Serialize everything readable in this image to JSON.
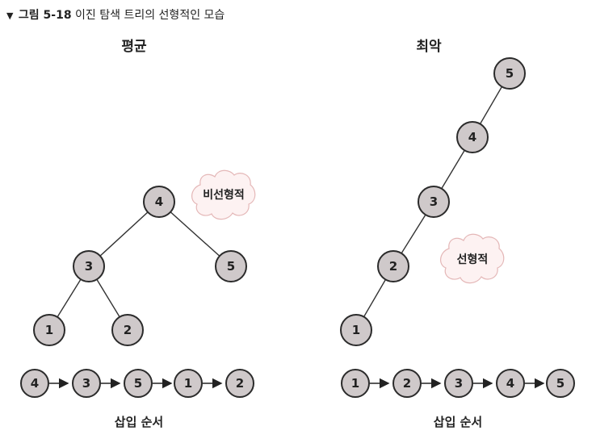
{
  "caption": {
    "marker": "▼",
    "figure_label": "그림 5-18",
    "text": "이진 탐색 트리의 선형적인 모습"
  },
  "panels": [
    {
      "title": "평균",
      "annotation": "비선형적",
      "tree_nodes": [
        "4",
        "3",
        "5",
        "1",
        "2"
      ],
      "tree_edges": [
        [
          "4",
          "3"
        ],
        [
          "4",
          "5"
        ],
        [
          "3",
          "1"
        ],
        [
          "3",
          "2"
        ]
      ],
      "insert_order": [
        "4",
        "3",
        "5",
        "1",
        "2"
      ],
      "insert_label": "삽입 순서"
    },
    {
      "title": "최악",
      "annotation": "선형적",
      "tree_nodes": [
        "5",
        "4",
        "3",
        "2",
        "1"
      ],
      "tree_edges": [
        [
          "5",
          "4"
        ],
        [
          "4",
          "3"
        ],
        [
          "3",
          "2"
        ],
        [
          "2",
          "1"
        ]
      ],
      "insert_order": [
        "1",
        "2",
        "3",
        "4",
        "5"
      ],
      "insert_label": "삽입 순서"
    }
  ],
  "colors": {
    "node_fill": "#cfc9ca",
    "node_stroke": "#2b2b2b",
    "cloud_fill": "#fdf2f2",
    "cloud_stroke": "#e4b7b7"
  }
}
